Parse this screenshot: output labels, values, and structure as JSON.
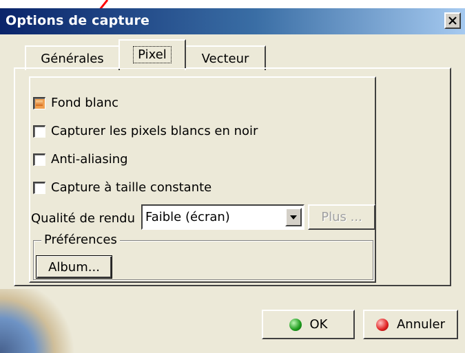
{
  "window": {
    "title": "Options de capture",
    "close_label": "×"
  },
  "tabs": [
    {
      "label": "Générales",
      "active": false
    },
    {
      "label": "Pixel",
      "active": true
    },
    {
      "label": "Vecteur",
      "active": false
    }
  ],
  "options": [
    {
      "label": "Fond blanc",
      "checked": true
    },
    {
      "label": "Capturer les pixels blancs en noir",
      "checked": false
    },
    {
      "label": "Anti-aliasing",
      "checked": false
    },
    {
      "label": "Capture à taille constante",
      "checked": false
    }
  ],
  "quality": {
    "label": "Qualité de rendu",
    "selected": "Faible (écran)",
    "more_label": "Plus ..."
  },
  "preferences": {
    "group_label": "Préférences",
    "album_label": "Album..."
  },
  "buttons": {
    "ok_label": "OK",
    "cancel_label": "Annuler"
  },
  "colors": {
    "title_bar_start": "#0a246a",
    "title_bar_end": "#a6caf0",
    "dialog_bg": "#ece9d8",
    "checked_box": "#f0a050",
    "ok_icon": "#1c9a1c",
    "cancel_icon": "#e02020",
    "annotation_arrow": "#ff0000"
  },
  "icons": {
    "close": "close-icon",
    "dropdown": "dropdown-arrow-icon",
    "ok": "green-light-icon",
    "cancel": "red-light-icon",
    "annotation": "red-arrow-icon"
  }
}
